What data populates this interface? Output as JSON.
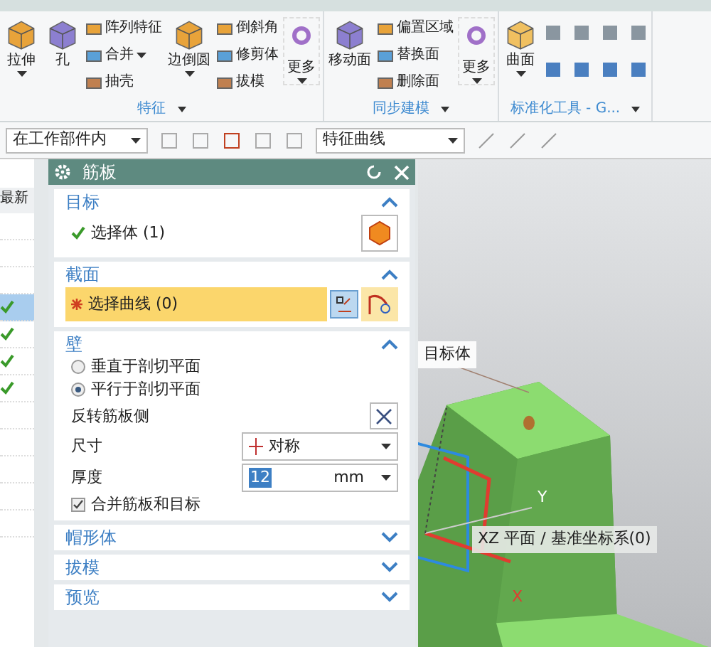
{
  "ribbon": {
    "groups": [
      {
        "label": "特征",
        "columns": [
          {
            "kind": "large",
            "items": [
              {
                "label": "拉伸",
                "dropdown": true
              }
            ]
          },
          {
            "kind": "large",
            "items": [
              {
                "label": "孔",
                "dropdown": false
              }
            ]
          },
          {
            "kind": "small",
            "items": [
              {
                "label": "阵列特征",
                "dropdown": false
              },
              {
                "label": "合并",
                "dropdown": true
              },
              {
                "label": "抽壳",
                "dropdown": false
              }
            ]
          },
          {
            "kind": "large",
            "items": [
              {
                "label": "边倒圆",
                "dropdown": true
              }
            ]
          },
          {
            "kind": "small",
            "items": [
              {
                "label": "倒斜角",
                "dropdown": false
              },
              {
                "label": "修剪体",
                "dropdown": false
              },
              {
                "label": "拔模",
                "dropdown": false
              }
            ]
          },
          {
            "kind": "more",
            "items": [
              {
                "label": "更多",
                "dropdown": true
              }
            ]
          }
        ]
      },
      {
        "label": "同步建模",
        "columns": [
          {
            "kind": "large",
            "items": [
              {
                "label": "移动面",
                "dropdown": false
              }
            ]
          },
          {
            "kind": "small",
            "items": [
              {
                "label": "偏置区域",
                "dropdown": false
              },
              {
                "label": "替换面",
                "dropdown": false
              },
              {
                "label": "删除面",
                "dropdown": false
              }
            ]
          },
          {
            "kind": "more",
            "items": [
              {
                "label": "更多",
                "dropdown": true
              }
            ]
          }
        ]
      },
      {
        "label": "标准化工具 - G...",
        "columns": [
          {
            "kind": "large",
            "items": [
              {
                "label": "曲面",
                "dropdown": true
              }
            ]
          },
          {
            "kind": "icons"
          }
        ]
      }
    ]
  },
  "toolbar": {
    "scope_filter": "在工作部件内",
    "curve_rule": "特征曲线"
  },
  "navigator": {
    "column": "最新",
    "rows": [
      {
        "checked": false,
        "selected": false
      },
      {
        "checked": false,
        "selected": false
      },
      {
        "checked": false,
        "selected": false
      },
      {
        "checked": true,
        "selected": true
      },
      {
        "checked": true,
        "selected": false
      },
      {
        "checked": true,
        "selected": false
      },
      {
        "checked": true,
        "selected": false
      },
      {
        "checked": false,
        "selected": false
      },
      {
        "checked": false,
        "selected": false
      },
      {
        "checked": false,
        "selected": false
      },
      {
        "checked": false,
        "selected": false
      },
      {
        "checked": false,
        "selected": false
      }
    ]
  },
  "dialog": {
    "title": "筋板",
    "sections": [
      {
        "kind": "target",
        "title": "目标",
        "expanded": true,
        "selection": "选择体 (1)",
        "done": true
      },
      {
        "kind": "section",
        "title": "截面",
        "expanded": true,
        "selection": "选择曲线 (0)",
        "done": false
      },
      {
        "kind": "wall",
        "title": "壁",
        "expanded": true,
        "options": [
          {
            "label": "垂直于剖切平面",
            "selected": false
          },
          {
            "label": "平行于剖切平面",
            "selected": true
          }
        ],
        "reverse_label": "反转筋板侧",
        "size_label": "尺寸",
        "size_value": "对称",
        "thickness_label": "厚度",
        "thickness_value": "12",
        "thickness_unit": "mm",
        "combine": {
          "label": "合并筋板和目标",
          "checked": true
        }
      },
      {
        "kind": "collapsed",
        "title": "帽形体",
        "expanded": false
      },
      {
        "kind": "collapsed",
        "title": "拔模",
        "expanded": false
      },
      {
        "kind": "collapsed",
        "title": "预览",
        "expanded": false
      }
    ]
  },
  "viewport": {
    "target_label": "目标体",
    "plane_label": "XZ 平面 / 基准坐标系(0)",
    "axis_y": "Y",
    "axis_x": "X"
  }
}
